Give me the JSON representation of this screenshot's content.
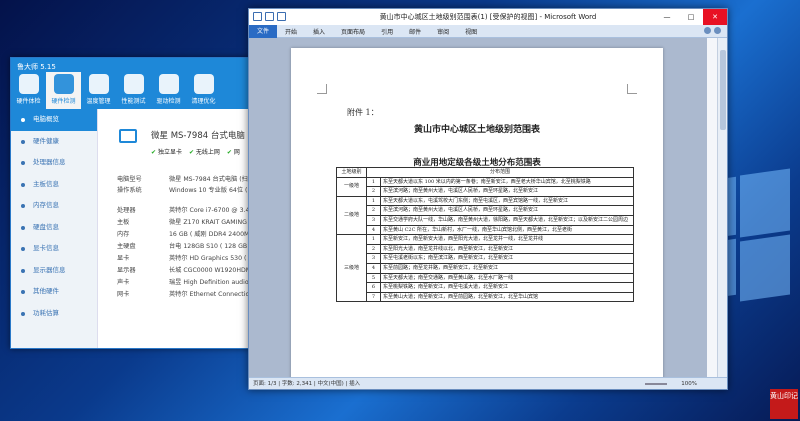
{
  "colors": {
    "accent": "#1e88d8",
    "word_blue": "#2a6bc4",
    "close_red": "#e81123",
    "seal_red": "#c41a1a"
  },
  "ludashi": {
    "title": "鲁大师 5.15",
    "tabs": [
      "硬件体检",
      "硬件检测",
      "温度管理",
      "性能测试",
      "驱动检测",
      "清理优化"
    ],
    "sidebar": [
      "电脑概览",
      "硬件健康",
      "处理器信息",
      "主板信息",
      "内存信息",
      "硬盘信息",
      "显卡信息",
      "显示器信息",
      "其他硬件",
      "功耗估算"
    ],
    "model": "微星 MS-7984 台式电脑",
    "checks": [
      "独立显卡",
      "无线上网",
      "网"
    ],
    "rows": [
      {
        "k": "电脑型号",
        "v": "微星 MS-7984 台式电脑 (扫描"
      },
      {
        "k": "操作系统",
        "v": "Windows 10 专业版 64位 ( Di"
      },
      {
        "k": "处理器",
        "v": "英特尔 Core i7-6700 @ 3.40G"
      },
      {
        "k": "主板",
        "v": "微星 Z170 KRAIT GAMING (MS"
      },
      {
        "k": "内存",
        "v": "16 GB ( 威刚 DDR4 2400MHz"
      },
      {
        "k": "主硬盘",
        "v": "台电 128GB S10 ( 128 GB /"
      },
      {
        "k": "显卡",
        "v": "英特尔 HD Graphics 530 ( 12"
      },
      {
        "k": "显示器",
        "v": "长城 CGC0000 W1920HDMI ("
      },
      {
        "k": "声卡",
        "v": "瑞昱 High Definition audio @"
      },
      {
        "k": "网卡",
        "v": "英特尔 Ethernet Connection"
      }
    ]
  },
  "word": {
    "title": "黄山市中心城区土地级别范围表(1) [受保护的视图] - Microsoft Word",
    "ribbon": [
      "文件",
      "开始",
      "插入",
      "页面布局",
      "引用",
      "邮件",
      "审阅",
      "视图"
    ],
    "status": "页面: 1/3  |  字数: 2,341  |  中文(中国)  |  插入",
    "zoom": "100%",
    "doc": {
      "attach": "附件 1：",
      "title": "黄山市中心城区土地级别范围表",
      "subtitle": "商业用地定级各级土地分布范围表",
      "header": [
        "土地级别",
        "分布范围"
      ],
      "groups": [
        {
          "level": "一级地",
          "rows": [
            {
              "no": "1",
              "text": "东至天都大道以东 100 米以内的第一条巷；南至新安江，西至老大桥华山宾馆，北至桃梨铁路"
            },
            {
              "no": "2",
              "text": "东至滨河路；南至黄州大道，屯溪区人民桥，西至环星路，北至新安江"
            }
          ]
        },
        {
          "level": "二级地",
          "rows": [
            {
              "no": "1",
              "text": "东至天都大道以东，屯溪驾校大门东侧；南至屯溪区，西至宾馆路一线，北至新安江"
            },
            {
              "no": "2",
              "text": "东至滨河路；南至黄州大道，屯溪区人民桥，西至环星路，北至新安江"
            },
            {
              "no": "3",
              "text": "东至交通学府大队一线，华山路，南至黄州大道，徐阳路，西至天都大道，北至新安江；以及新安江二公园周边"
            },
            {
              "no": "4",
              "text": "东至黄山 C2C 所在，华山新村，水厂一线，南至华山宾馆北侧，西至黄江，北至老街"
            }
          ]
        },
        {
          "level": "三级地",
          "rows": [
            {
              "no": "1",
              "text": "东至新安江，南至新安大道，西至阳光大道，北至龙井一线，北至龙井线"
            },
            {
              "no": "2",
              "text": "东至阳光大道，南至龙井线以北，西至新安江，北至新安江"
            },
            {
              "no": "3",
              "text": "东至屯溪老街以东；南至滨江路，西至新安江，北至新安江"
            },
            {
              "no": "4",
              "text": "东至前园路；南至龙井路，西至新安江，北至新安江"
            },
            {
              "no": "5",
              "text": "东至天都大道；南至交通路，西至黄山路，北至水厂路一线"
            },
            {
              "no": "6",
              "text": "东至桃梨铁路；南至新安江，西至屯溪大道，北至新安江"
            },
            {
              "no": "7",
              "text": "东至黄山大道；南至新安江，西至前园路，北至新安江，北至华山宾馆"
            }
          ]
        }
      ]
    }
  },
  "seal_text": "黄山印记"
}
